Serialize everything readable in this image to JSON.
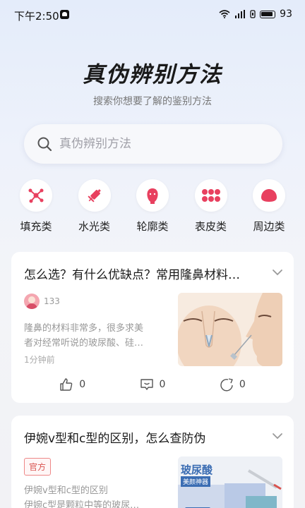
{
  "status_bar": {
    "time": "下午2:50",
    "battery": "93",
    "icons": [
      "notification-icon",
      "wifi-icon",
      "signal-icon",
      "battery-icon"
    ]
  },
  "header": {
    "title": "真伪辨别方法",
    "subtitle": "搜索你想要了解的鉴别方法"
  },
  "search": {
    "placeholder": "真伪辨别方法"
  },
  "categories": [
    {
      "label": "填充类",
      "icon": "molecule-icon"
    },
    {
      "label": "水光类",
      "icon": "syringe-icon"
    },
    {
      "label": "轮廓类",
      "icon": "face-contour-icon"
    },
    {
      "label": "表皮类",
      "icon": "skin-dots-icon"
    },
    {
      "label": "周边类",
      "icon": "accessory-icon"
    }
  ],
  "articles": [
    {
      "title": "怎么选？有什么优缺点？常用隆鼻材料…",
      "author_count": "133",
      "excerpt_line1": "隆鼻的材料非常多，很多求美",
      "excerpt_line2": "者对经常听说的玻尿酸、硅…",
      "time": "1分钟前",
      "likes": "0",
      "comments": "0",
      "shares": "0"
    },
    {
      "title": "伊婉v型和c型的区别，怎么查防伪",
      "badge": "官方",
      "excerpt_line1": "伊婉v型和c型的区别",
      "excerpt_line2": "伊婉c型是颗粒中等的玻尿…",
      "thumb_text1": "玻尿酸",
      "thumb_text2": "美颜神器"
    }
  ],
  "colors": {
    "accent_pink": "#e8405f",
    "badge_red": "#d9534f"
  }
}
